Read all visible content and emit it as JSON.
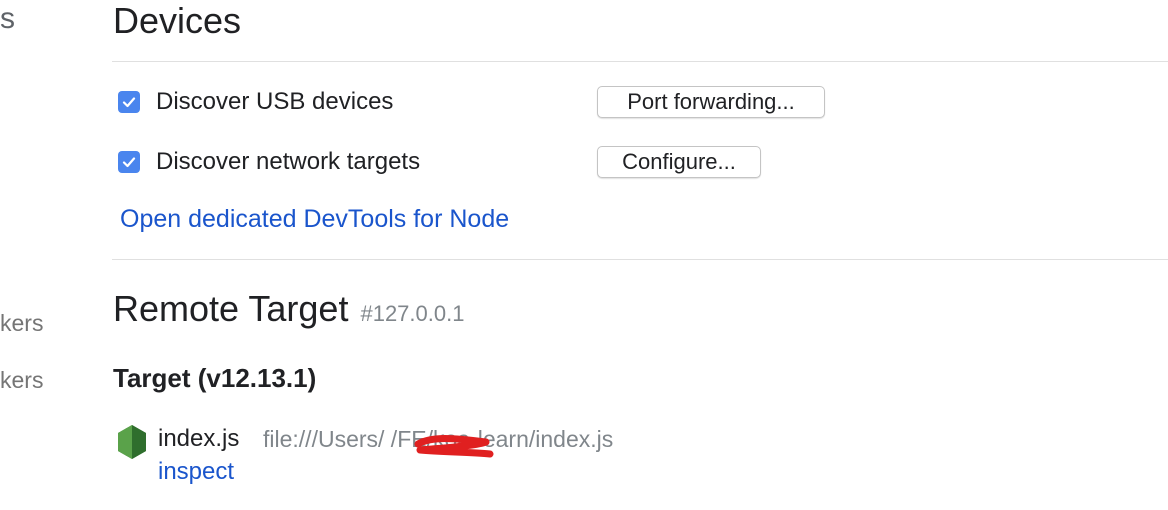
{
  "sidebar": {
    "fragments": [
      "s",
      "kers",
      "kers"
    ]
  },
  "devices": {
    "title": "Devices",
    "options": [
      {
        "label": "Discover USB devices",
        "checked": true,
        "button": "Port forwarding..."
      },
      {
        "label": "Discover network targets",
        "checked": true,
        "button": "Configure..."
      }
    ],
    "devtools_link": "Open dedicated DevTools for Node"
  },
  "remote": {
    "title": "Remote Target",
    "address": "#127.0.0.1",
    "target_title": "Target (v12.13.1)",
    "targets": [
      {
        "icon": "nodejs-hexagon-icon",
        "name": "index.js",
        "url": "file:///Users/          /FE/koa-learn/index.js",
        "action": "inspect"
      }
    ]
  },
  "colors": {
    "accent": "#4a85ee",
    "link": "#1a55cc",
    "node_green": "#3c873a",
    "redaction": "#e02020"
  }
}
